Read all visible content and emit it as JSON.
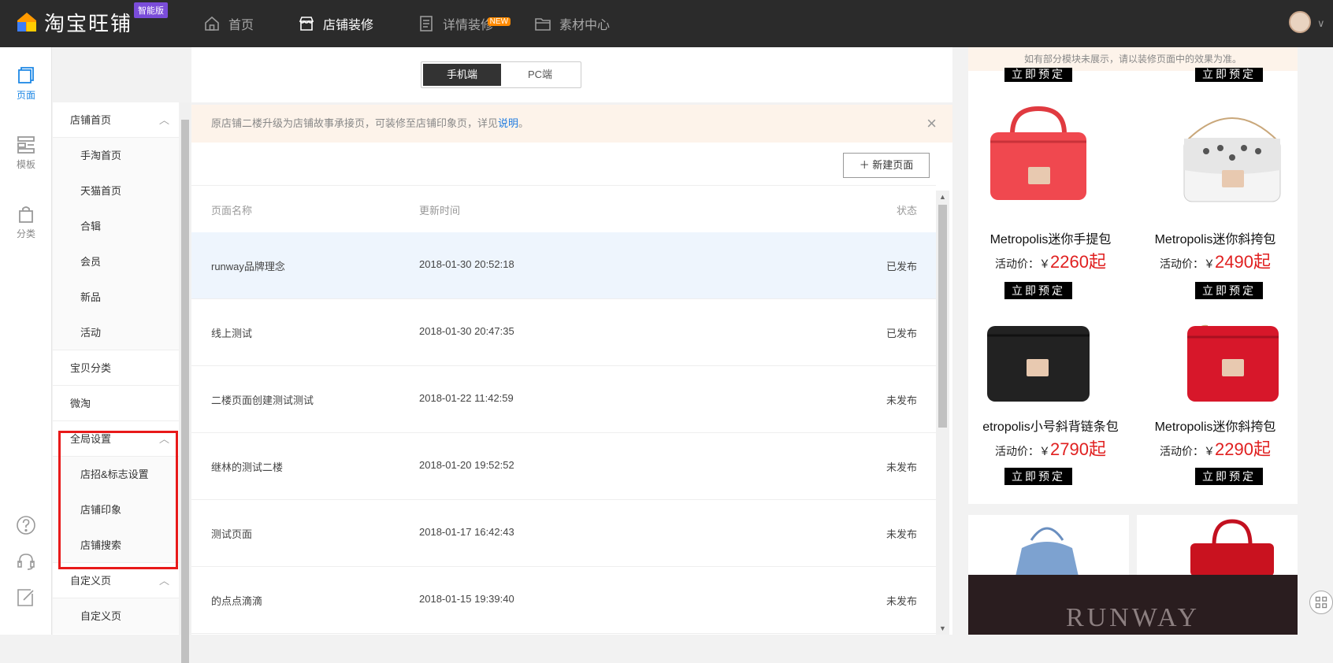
{
  "topbar": {
    "logo_text": "淘宝旺铺",
    "edition_badge": "智能版",
    "nav": [
      {
        "label": "首页",
        "icon": "home-icon"
      },
      {
        "label": "店铺装修",
        "icon": "store-icon",
        "active": true
      },
      {
        "label": "详情装修",
        "icon": "document-icon",
        "badge": "NEW"
      },
      {
        "label": "素材中心",
        "icon": "folder-icon"
      }
    ],
    "caret": "∨"
  },
  "rail": {
    "items": [
      {
        "label": "页面",
        "icon": "page-icon",
        "active": true
      },
      {
        "label": "模板",
        "icon": "template-icon"
      },
      {
        "label": "分类",
        "icon": "bag-icon"
      }
    ],
    "bottom_icons": [
      "help-icon",
      "headset-icon",
      "edit-icon"
    ]
  },
  "tree": {
    "nodes": [
      {
        "label": "店铺首页",
        "level": 0,
        "caret": "︿"
      },
      {
        "label": "手淘首页",
        "level": 1
      },
      {
        "label": "天猫首页",
        "level": 1
      },
      {
        "label": "合辑",
        "level": 1
      },
      {
        "label": "会员",
        "level": 1
      },
      {
        "label": "新品",
        "level": 1
      },
      {
        "label": "活动",
        "level": 1
      },
      {
        "label": "宝贝分类",
        "level": 0
      },
      {
        "label": "微淘",
        "level": 0
      },
      {
        "label": "全局设置",
        "level": 0,
        "caret": "︿"
      },
      {
        "label": "店招&标志设置",
        "level": 1
      },
      {
        "label": "店铺印象",
        "level": 1
      },
      {
        "label": "店铺搜索",
        "level": 1
      },
      {
        "label": "自定义页",
        "level": 0,
        "caret": "︿"
      },
      {
        "label": "自定义页",
        "level": 1
      }
    ]
  },
  "main": {
    "segment": {
      "mobile": "手机端",
      "pc": "PC端"
    },
    "notice": {
      "text": "原店铺二楼升级为店铺故事承接页，可装修至店铺印象页，详见",
      "link": "说明",
      "suffix": "。",
      "close": "×"
    },
    "new_page_button": "＋ 新建页面",
    "table": {
      "headers": [
        "页面名称",
        "更新时间",
        "状态"
      ],
      "rows": [
        {
          "name": "runway品牌理念",
          "time": "2018-01-30 20:52:18",
          "status": "已发布"
        },
        {
          "name": "线上测试",
          "time": "2018-01-30 20:47:35",
          "status": "已发布"
        },
        {
          "name": "二楼页面创建测试测试",
          "time": "2018-01-22 11:42:59",
          "status": "未发布"
        },
        {
          "name": "继林的测试二楼",
          "time": "2018-01-20 19:52:52",
          "status": "未发布"
        },
        {
          "name": "测试页面",
          "time": "2018-01-17 16:42:43",
          "status": "未发布"
        },
        {
          "name": "的点点滴滴",
          "time": "2018-01-15 19:39:40",
          "status": "未发布"
        }
      ]
    }
  },
  "preview": {
    "note": "如有部分模块未展示，请以装修页面中的效果为准。",
    "book_label": "立即预定",
    "products": [
      {
        "title": "Metropolis迷你手提包",
        "price_label": "活动价：￥",
        "price": "2260起",
        "color": "#f0484f"
      },
      {
        "title": "Metropolis迷你斜挎包",
        "price_label": "活动价：￥",
        "price": "2490起",
        "color": "#f4f4f4"
      },
      {
        "title": "etropolis小号斜背链条包",
        "price_label": "活动价：￥",
        "price": "2790起",
        "color": "#222222"
      },
      {
        "title": "Metropolis迷你斜挎包",
        "price_label": "活动价：￥",
        "price": "2290起",
        "color": "#d7172a"
      }
    ],
    "banner_text": "RUNWAY"
  }
}
